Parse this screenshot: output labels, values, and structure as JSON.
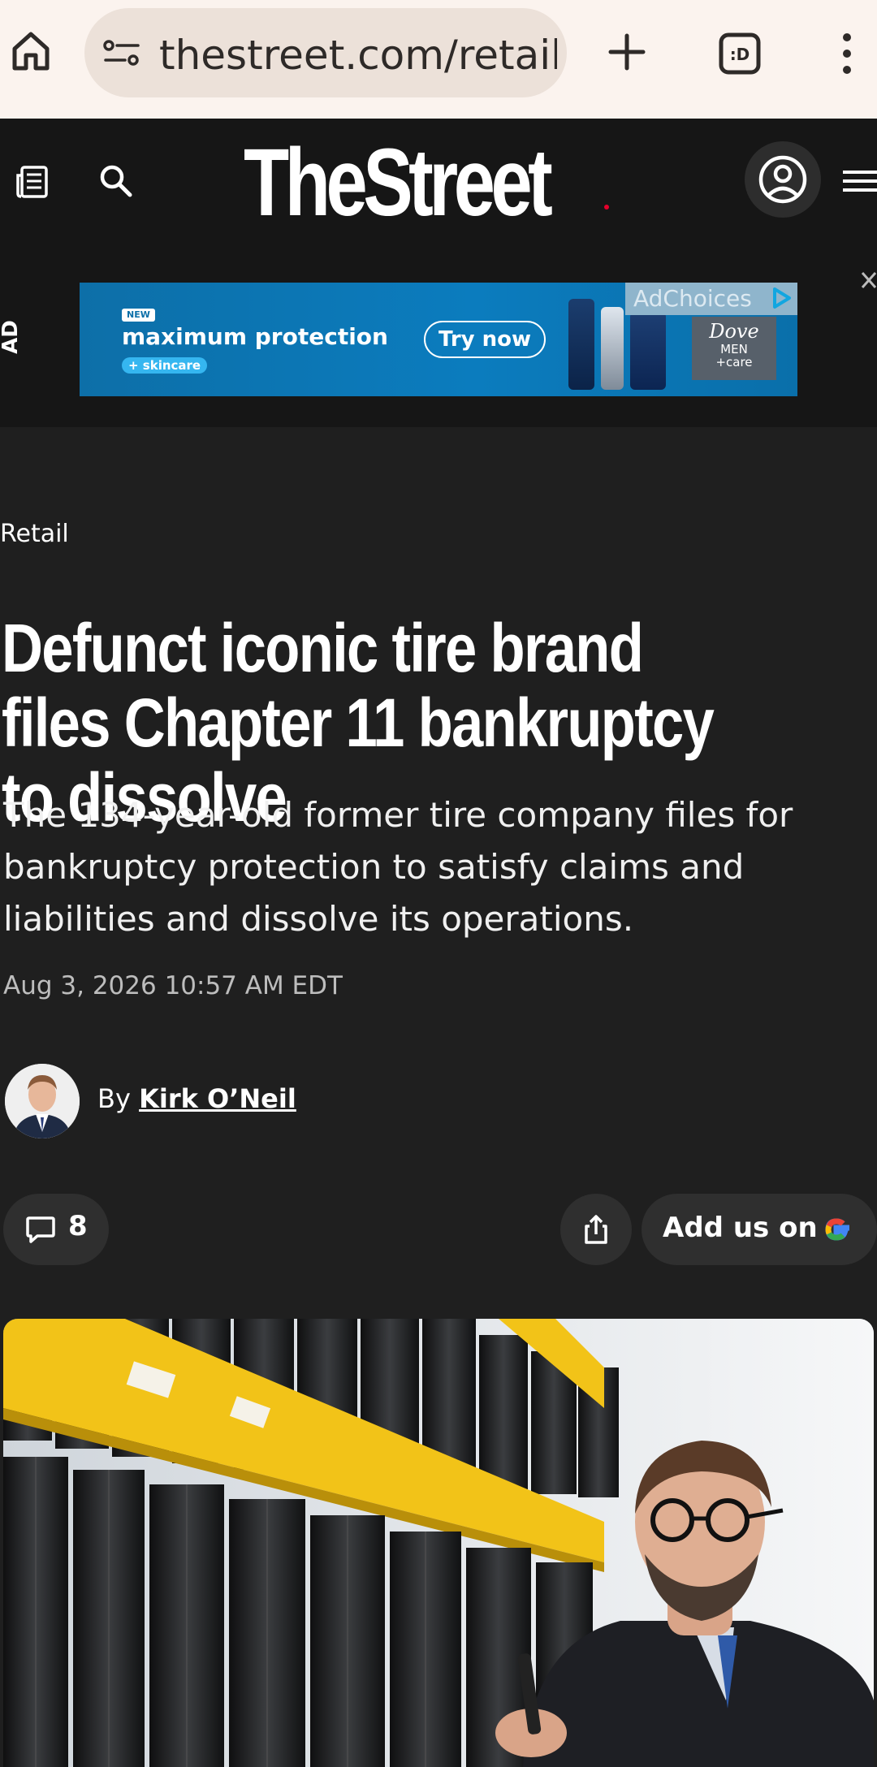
{
  "browser": {
    "url": "thestreet.com/retail",
    "tab_icon_label": ":D"
  },
  "site": {
    "logo_text": "TheStreet"
  },
  "ad": {
    "side_label": "AD",
    "badge": "NEW",
    "headline": "maximum protection",
    "sub": "+ skincare",
    "cta": "Try now",
    "adchoices": "AdChoices",
    "brand_line1": "Dove",
    "brand_line2": "MEN",
    "brand_line3": "+care"
  },
  "article": {
    "category": "Retail",
    "headline": "Defunct iconic tire brand files Chapter 11 bankruptcy to dissolve",
    "dek": "The 134-year-old former tire company files for bankruptcy protection to satisfy claims and liabilities and dissolve its operations.",
    "timestamp": "Aug 3, 2026 10:57 AM EDT",
    "byline_prefix": "By ",
    "author": "Kirk O’Neil",
    "comment_count": "8",
    "google_label": "Add us on"
  },
  "colors": {
    "page_bg": "#1f1f1f",
    "header_bg": "#161616",
    "browser_bg": "#fbf3ee",
    "pill_bg": "#2f2f2f",
    "ad_blue": "#0b7cbe",
    "shelf_yellow": "#f2c318"
  },
  "icons": [
    "home-icon",
    "tune-icon",
    "plus-icon",
    "tab-switcher-icon",
    "more-vert-icon",
    "newspaper-icon",
    "search-icon",
    "account-icon",
    "hamburger-icon",
    "close-icon",
    "comment-icon",
    "share-icon",
    "google-icon"
  ]
}
